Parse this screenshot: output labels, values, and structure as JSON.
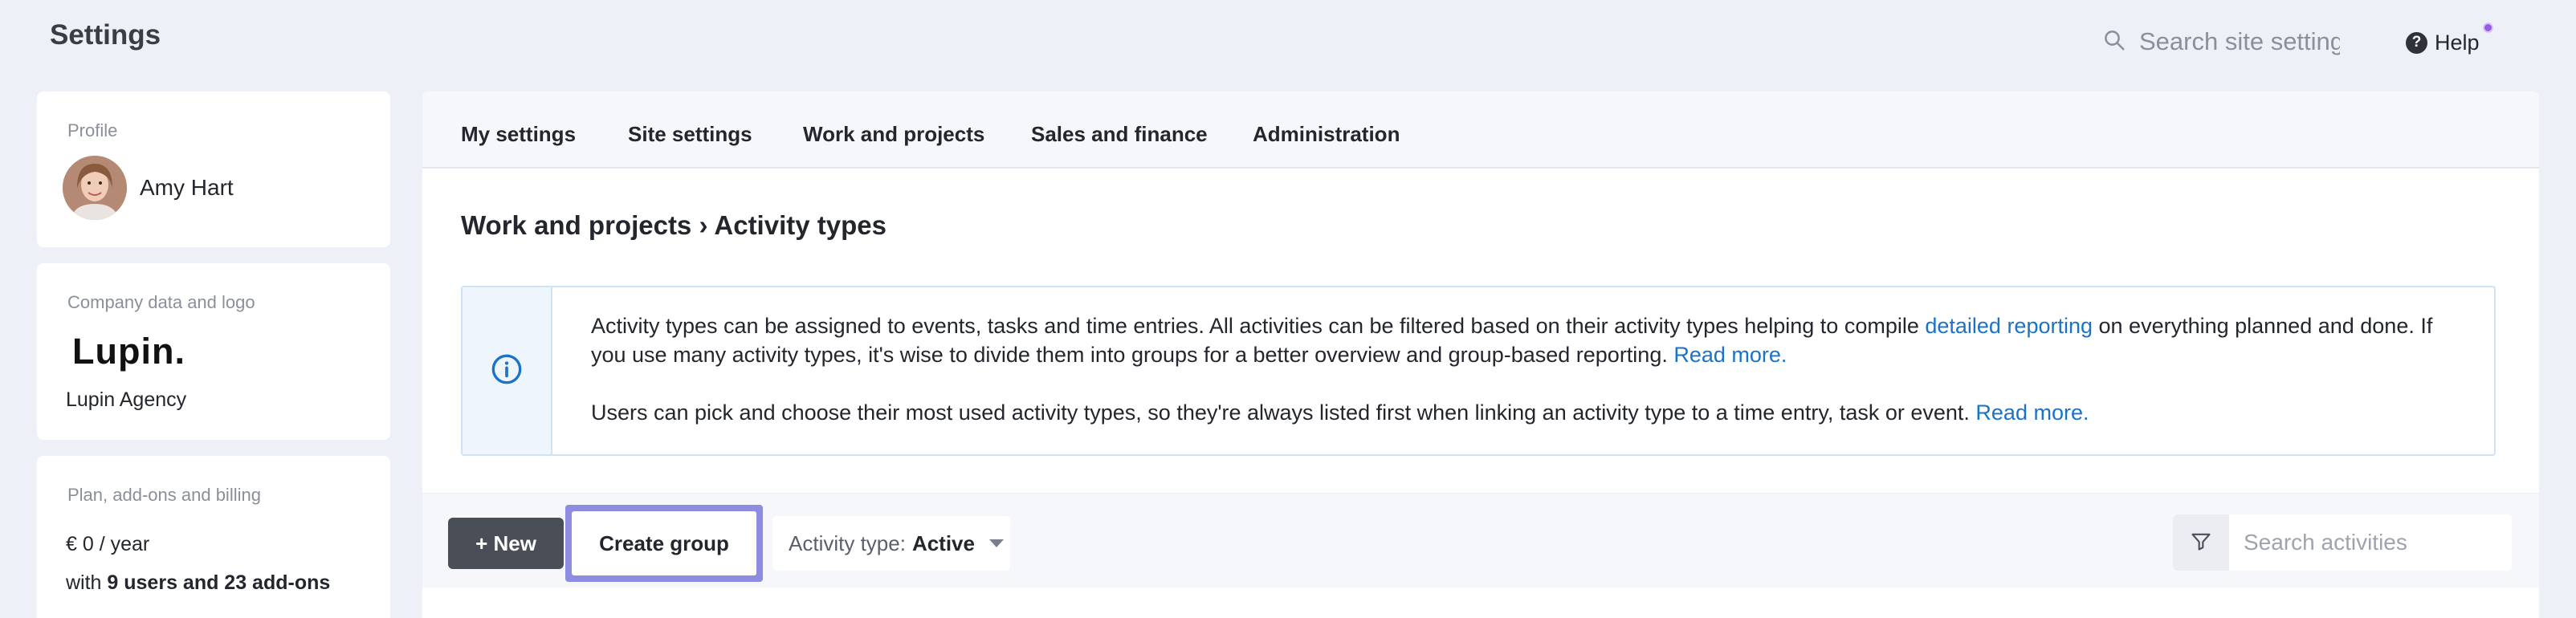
{
  "header": {
    "title": "Settings",
    "search_placeholder": "Search site settings",
    "help_label": "Help"
  },
  "sidebar": {
    "profile": {
      "label": "Profile",
      "name": "Amy Hart"
    },
    "company": {
      "label": "Company data and logo",
      "logo_text": "Lupin.",
      "name": "Lupin Agency"
    },
    "billing": {
      "label": "Plan, add-ons and billing",
      "price": "€ 0 / year",
      "users_prefix": "with ",
      "users_bold": "9 users and 23 add-ons"
    }
  },
  "tabs": [
    {
      "label": "My settings"
    },
    {
      "label": "Site settings"
    },
    {
      "label": "Work and projects"
    },
    {
      "label": "Sales and finance"
    },
    {
      "label": "Administration"
    }
  ],
  "breadcrumb": "Work and projects › Activity types",
  "info": {
    "p1_a": "Activity types can be assigned to events, tasks and time entries. All activities can be filtered based on their activity types helping to compile ",
    "p1_link": "detailed reporting",
    "p1_b": " on everything planned and done. If you use many activity types, it's wise to divide them into groups for a better overview and group-based reporting. ",
    "p1_more": "Read more.",
    "p2_a": "Users can pick and choose their most used activity types, so they're always listed first when linking an activity type to a time entry, task or event. ",
    "p2_more": "Read more."
  },
  "toolbar": {
    "new_label": "+ New",
    "create_group_label": "Create group",
    "filter_prefix": "Activity type:",
    "filter_value": "Active",
    "search_placeholder": "Search activities"
  },
  "colors": {
    "accent_link": "#1a73c9",
    "highlight": "#8e8ce0",
    "new_button": "#4a4e57",
    "notification_dot": "#9b59e8"
  }
}
